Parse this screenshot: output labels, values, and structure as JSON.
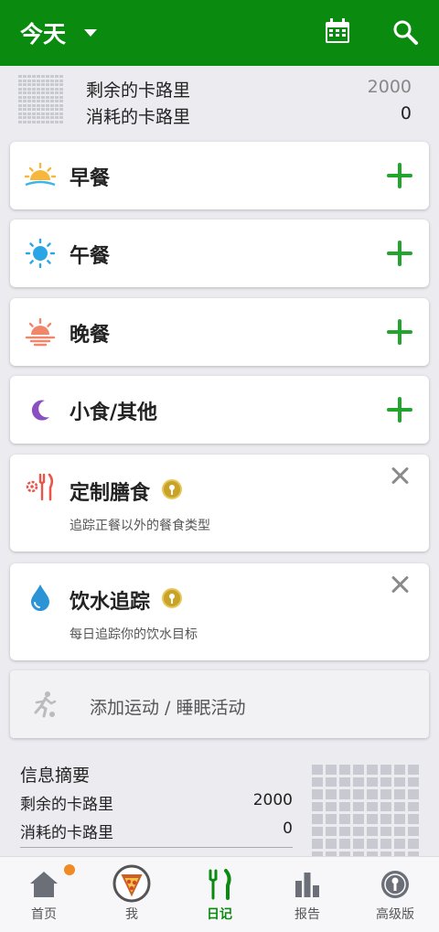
{
  "header": {
    "title": "今天",
    "calendar_icon": "calendar-icon",
    "search_icon": "search-icon",
    "bg_color": "#0b8a10"
  },
  "summary_top": {
    "remaining_label": "剩余的卡路里",
    "remaining_value": "2000",
    "consumed_label": "消耗的卡路里",
    "consumed_value": "0"
  },
  "meals": [
    {
      "label": "早餐",
      "icon": "sunrise-icon"
    },
    {
      "label": "午餐",
      "icon": "sun-icon"
    },
    {
      "label": "晚餐",
      "icon": "sunset-icon"
    },
    {
      "label": "小食/其他",
      "icon": "moon-icon"
    }
  ],
  "feature_cards": [
    {
      "label": "定制膳食",
      "subtitle": "追踪正餐以外的餐食类型",
      "icon": "fork-knife-gear-icon"
    },
    {
      "label": "饮水追踪",
      "subtitle": "每日追踪你的饮水目标",
      "icon": "water-drop-icon"
    }
  ],
  "exercise": {
    "label": "添加运动 / 睡眠活动",
    "icon": "running-icon"
  },
  "info_summary": {
    "title": "信息摘要",
    "remaining_label": "剩余的卡路里",
    "remaining_value": "2000",
    "consumed_label": "消耗的卡路里",
    "consumed_value": "0"
  },
  "nav": [
    {
      "label": "首页",
      "icon": "home-icon",
      "notification": true
    },
    {
      "label": "我",
      "icon": "avatar-pizza-icon"
    },
    {
      "label": "日记",
      "icon": "fork-knife-icon",
      "active": true
    },
    {
      "label": "报告",
      "icon": "bar-chart-icon"
    },
    {
      "label": "高级版",
      "icon": "premium-badge-icon"
    }
  ],
  "accent_color": "#21a52e"
}
